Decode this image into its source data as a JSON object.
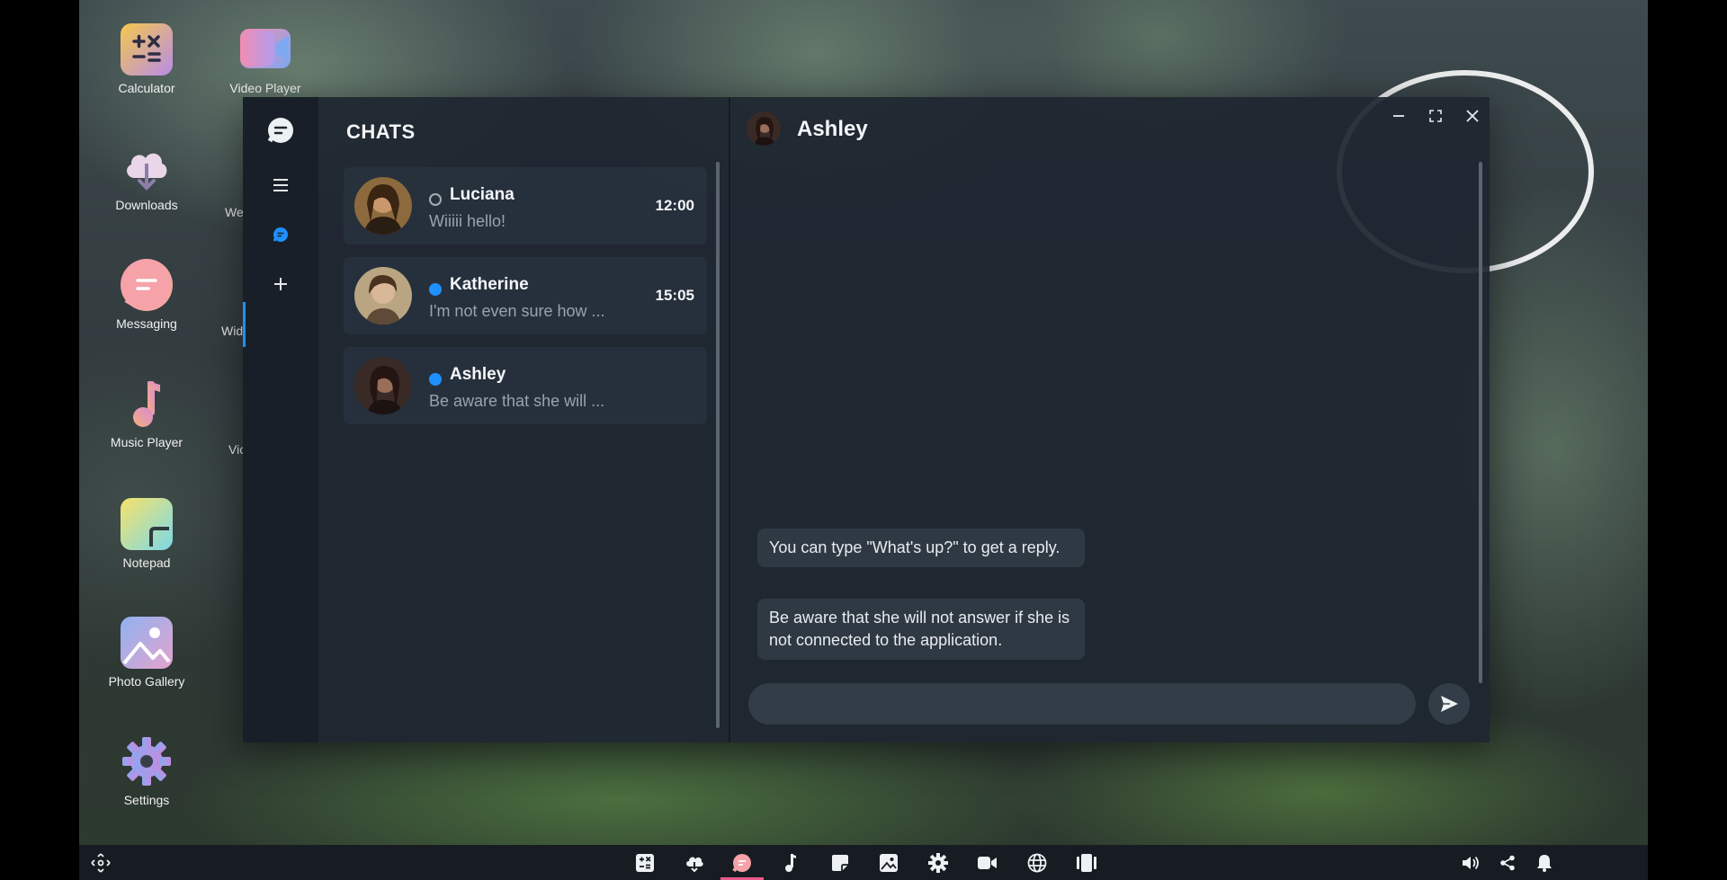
{
  "desktop": {
    "icons": [
      {
        "label": "Calculator"
      },
      {
        "label": "Video Player"
      },
      {
        "label": "Downloads"
      },
      {
        "label": "Messaging"
      },
      {
        "label": "Music Player"
      },
      {
        "label": "Notepad"
      },
      {
        "label": "Photo Gallery"
      },
      {
        "label": "Settings"
      }
    ],
    "partial_labels": [
      "We",
      "Wid",
      "Vic"
    ]
  },
  "window": {
    "sidebar": {
      "icons": [
        "chat-logo-icon",
        "menu-icon",
        "chat-icon",
        "plus-icon"
      ]
    },
    "chats_title": "CHATS",
    "chats": [
      {
        "name": "Luciana",
        "preview": "Wiiiii hello!",
        "time": "12:00",
        "status": "offline"
      },
      {
        "name": "Katherine",
        "preview": "I'm not even sure how ...",
        "time": "15:05",
        "status": "online"
      },
      {
        "name": "Ashley",
        "preview": "Be aware that she will ...",
        "time": "",
        "status": "online"
      }
    ],
    "conversation": {
      "contact_name": "Ashley",
      "messages": [
        "You can type \"What's up?\" to get a reply.",
        "Be aware that she will not answer if she is not connected to the application."
      ],
      "input_value": "",
      "input_placeholder": ""
    },
    "controls": [
      "minimize-icon",
      "maximize-icon",
      "close-icon"
    ]
  },
  "taskbar": {
    "left_icon": "move-icon",
    "apps": [
      "calculator-icon",
      "downloads-icon",
      "messaging-icon",
      "music-icon",
      "notepad-icon",
      "photo-gallery-icon",
      "settings-icon",
      "video-icon",
      "browser-icon",
      "widgets-icon"
    ],
    "active_app": "messaging-icon",
    "right_icons": [
      "volume-icon",
      "share-icon",
      "bell-icon"
    ]
  },
  "colors": {
    "accent": "#1e90ff",
    "active_indicator": "#e85a8c",
    "window_bg": "#1e2630",
    "taskbar_bg": "#161c22"
  }
}
